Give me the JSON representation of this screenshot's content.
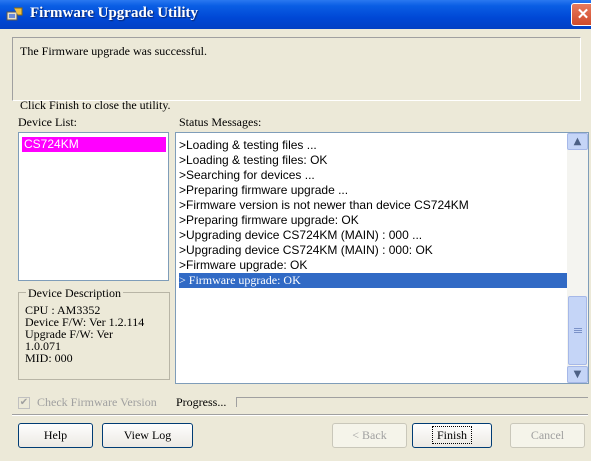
{
  "window": {
    "title": "Firmware Upgrade Utility",
    "close_glyph": "✕"
  },
  "messages": {
    "success": "The Firmware upgrade was successful.",
    "instruction": "Click Finish to close the utility."
  },
  "device_list": {
    "label": "Device List:",
    "items": [
      "CS724KM"
    ],
    "selected_color": "#ff00ff"
  },
  "device_description": {
    "legend": "Device Description",
    "lines": [
      "CPU : AM3352",
      "Device F/W: Ver 1.2.114",
      "Upgrade F/W: Ver",
      "1.0.071",
      "MID: 000"
    ]
  },
  "status": {
    "label": "Status Messages:",
    "lines": [
      ">Loading & testing files ...",
      ">Loading & testing files: OK",
      ">Searching for devices ...",
      ">Preparing firmware upgrade ...",
      ">Firmware version is not newer than device CS724KM",
      ">Preparing firmware upgrade: OK",
      ">Upgrading device CS724KM (MAIN) : 000 ...",
      ">Upgrading device CS724KM (MAIN) : 000: OK",
      ">Firmware upgrade: OK",
      "> Firmware upgrade: OK"
    ],
    "selected_index": 9,
    "selection_color": "#316ac5"
  },
  "options": {
    "check_firmware_label": "Check Firmware Version",
    "check_firmware_checked": true,
    "check_glyph": "✔",
    "progress_label": "Progress..."
  },
  "buttons": {
    "help": "Help",
    "view_log": "View Log",
    "back": "< Back",
    "finish": "Finish",
    "cancel": "Cancel"
  },
  "icons": {
    "scroll_up": "▲",
    "scroll_down": "▼"
  },
  "colors": {
    "titlebar": "#0048d6",
    "close": "#d04a2a"
  }
}
